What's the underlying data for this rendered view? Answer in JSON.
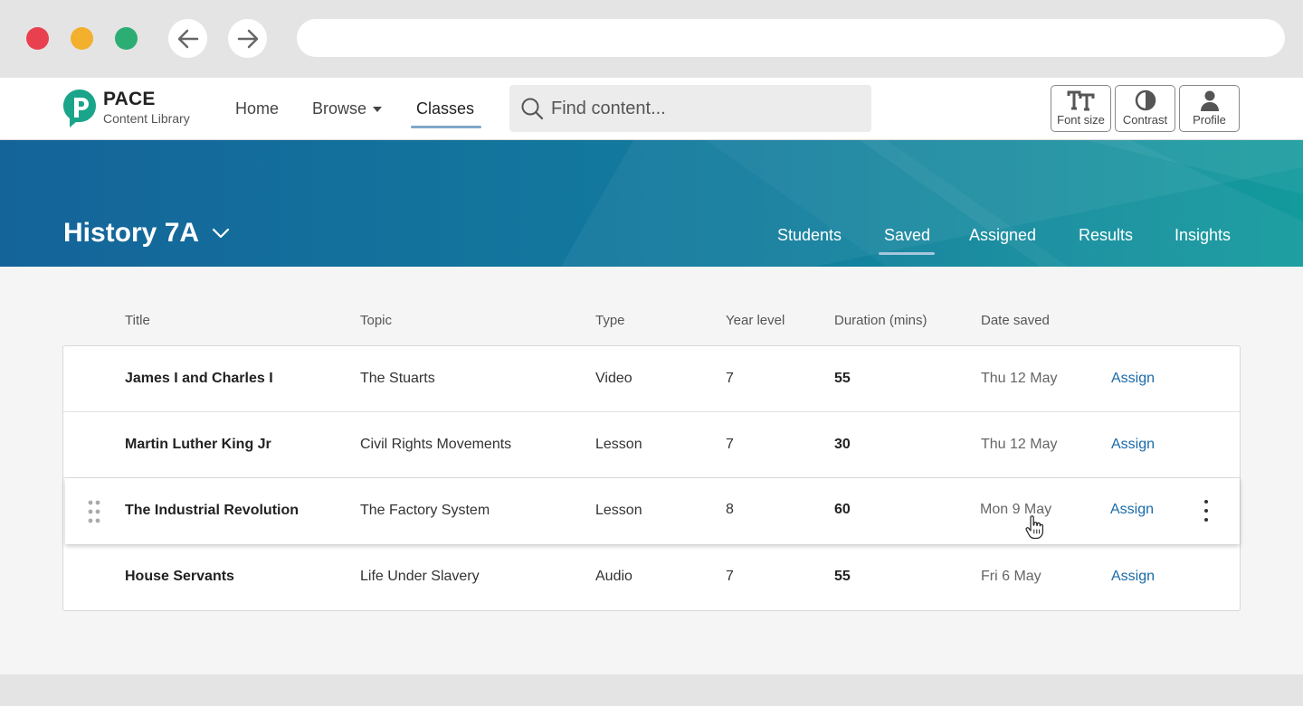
{
  "app": {
    "brand_name": "PACE",
    "brand_sub": "Content Library",
    "nav": {
      "home": "Home",
      "browse": "Browse",
      "classes": "Classes"
    },
    "search_placeholder": "Find content...",
    "tools": {
      "font_size": "Font size",
      "contrast": "Contrast",
      "profile": "Profile"
    }
  },
  "class_header": {
    "title": "History 7A",
    "tabs": {
      "students": "Students",
      "saved": "Saved",
      "assigned": "Assigned",
      "results": "Results",
      "insights": "Insights"
    },
    "active_tab": "Saved"
  },
  "table": {
    "headers": {
      "title": "Title",
      "topic": "Topic",
      "type": "Type",
      "year": "Year level",
      "duration": "Duration (mins)",
      "date": "Date saved"
    },
    "rows": [
      {
        "title": "James I and Charles I",
        "topic": "The Stuarts",
        "type": "Video",
        "year": "7",
        "duration": "55",
        "date": "Thu 12 May",
        "action": "Assign"
      },
      {
        "title": "Martin Luther King Jr",
        "topic": "Civil Rights Movements",
        "type": "Lesson",
        "year": "7",
        "duration": "30",
        "date": "Thu 12 May",
        "action": "Assign"
      },
      {
        "title": "The Industrial Revolution",
        "topic": "The Factory System",
        "type": "Lesson",
        "year": "8",
        "duration": "60",
        "date": "Mon 9 May",
        "action": "Assign"
      },
      {
        "title": "House Servants",
        "topic": "Life Under Slavery",
        "type": "Audio",
        "year": "7",
        "duration": "55",
        "date": "Fri 6 May",
        "action": "Assign"
      }
    ],
    "hovered_row": 2
  },
  "colors": {
    "brand_teal": "#1aa58a",
    "link_blue": "#1a6aa8",
    "banner_start": "#14649a",
    "banner_end": "#139a9c"
  },
  "icons": [
    "back-arrow-icon",
    "forward-arrow-icon",
    "pace-logo",
    "caret-down-icon",
    "search-icon",
    "font-size-icon",
    "contrast-icon",
    "profile-icon",
    "chevron-down-icon",
    "drag-handle-icon",
    "kebab-menu-icon",
    "hand-cursor-icon"
  ]
}
